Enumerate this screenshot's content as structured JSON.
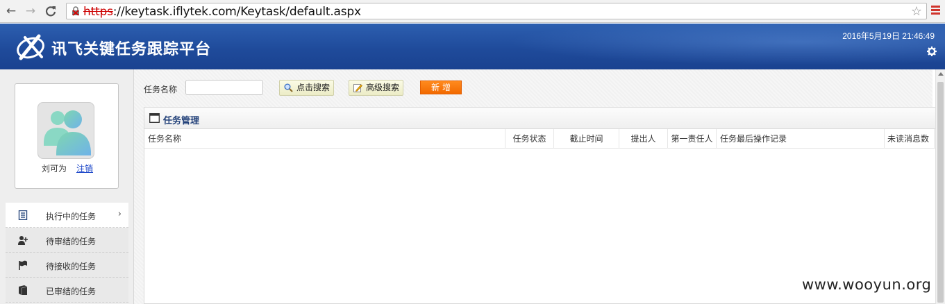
{
  "browser": {
    "url_scheme": "https",
    "url_rest": "://keytask.iflytek.com/Keytask/default.aspx",
    "back_icon": "←",
    "forward_icon": "→",
    "reload_icon": "C",
    "star_icon": "☆"
  },
  "header": {
    "app_title": "讯飞关键任务跟踪平台",
    "datetime": "2016年5月19日 21:46:49",
    "brand_color": "#1f4b9b"
  },
  "user": {
    "name": "刘可为",
    "logout_label": "注销"
  },
  "sidebar": {
    "items": [
      {
        "label": "执行中的任务",
        "icon": "document-list-icon",
        "active": true
      },
      {
        "label": "待审结的任务",
        "icon": "user-add-icon",
        "active": false
      },
      {
        "label": "待接收的任务",
        "icon": "flag-icon",
        "active": false
      },
      {
        "label": "已审结的任务",
        "icon": "book-icon",
        "active": false
      }
    ],
    "chevron": "›"
  },
  "toolbar": {
    "search_label": "任务名称",
    "search_value": "",
    "search_button": "点击搜索",
    "advanced_button": "高级搜索",
    "new_button": "新增"
  },
  "panel": {
    "title": "任务管理",
    "columns": [
      "任务名称",
      "任务状态",
      "截止时间",
      "提出人",
      "第一责任人",
      "任务最后操作记录",
      "未读消息数"
    ]
  },
  "watermark": "www.wooyun.org"
}
